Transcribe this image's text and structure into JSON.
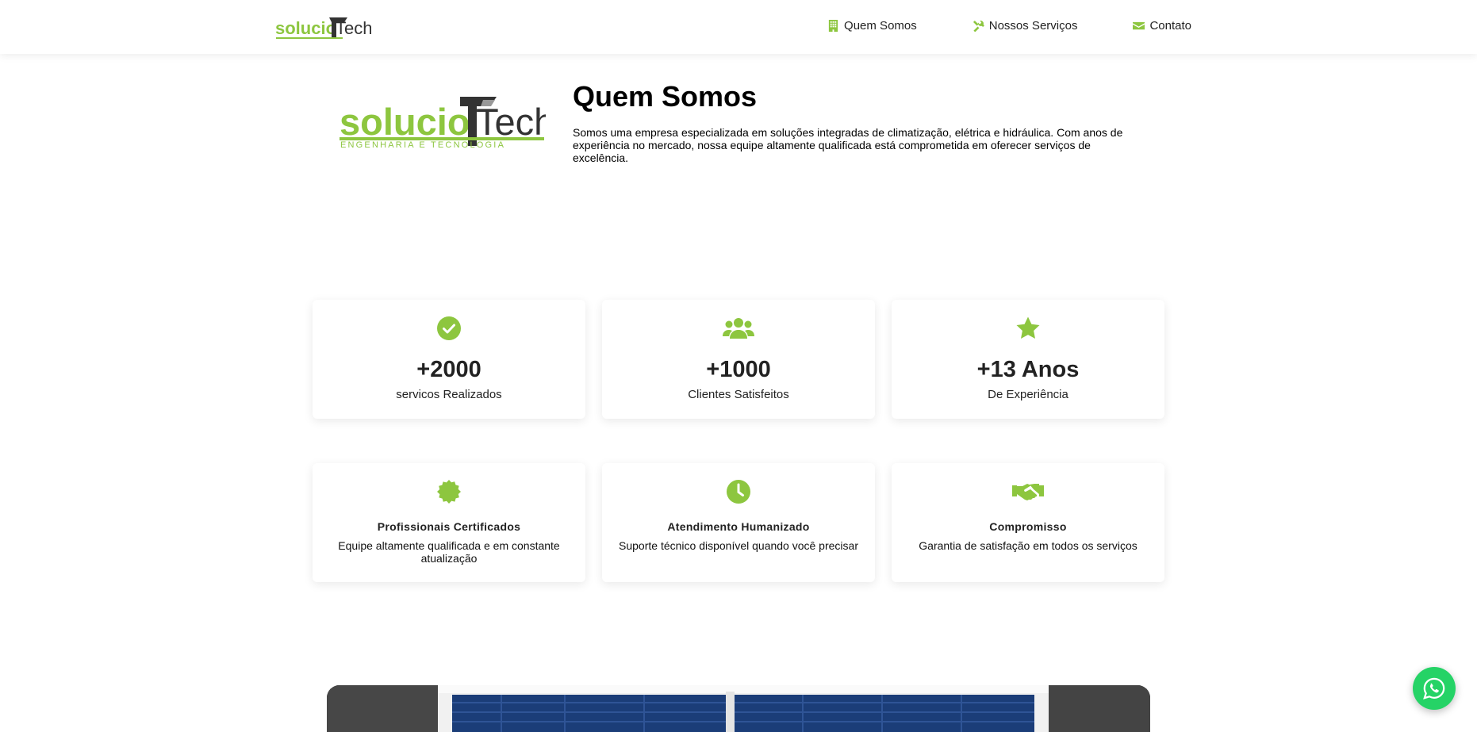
{
  "brand": {
    "logo_main": "solucio",
    "logo_accent": "Tech",
    "logo_tagline": "ENGENHARIA E TECNOLOGIA",
    "accent_color": "#8dc63f",
    "dark_color": "#333333"
  },
  "nav": {
    "items": [
      {
        "label": "Quem Somos",
        "icon": "building-icon"
      },
      {
        "label": "Nossos Serviços",
        "icon": "tools-icon"
      },
      {
        "label": "Contato",
        "icon": "envelope-icon"
      }
    ]
  },
  "about": {
    "title": "Quem Somos",
    "text": "Somos uma empresa especializada em soluções integradas de climatização, elétrica e hidráulica. Com anos de experiência no mercado, nossa equipe altamente qualificada está comprometida em oferecer serviços de excelência."
  },
  "stats": [
    {
      "icon": "check-circle-icon",
      "value": "+2000",
      "label": "servicos Realizados"
    },
    {
      "icon": "users-icon",
      "value": "+1000",
      "label": "Clientes Satisfeitos"
    },
    {
      "icon": "star-icon",
      "value": "+13 Anos",
      "label": "De Experiência"
    }
  ],
  "features": [
    {
      "icon": "certificate-icon",
      "title": "Profissionais Certificados",
      "description": "Equipe altamente qualificada e em constante atualização"
    },
    {
      "icon": "clock-icon",
      "title": "Atendimento Humanizado",
      "description": "Suporte técnico disponível quando você precisar"
    },
    {
      "icon": "handshake-icon",
      "title": "Compromisso",
      "description": "Garantia de satisfação em todos os serviços"
    }
  ],
  "whatsapp": {
    "icon": "whatsapp-icon",
    "color": "#25d366"
  }
}
